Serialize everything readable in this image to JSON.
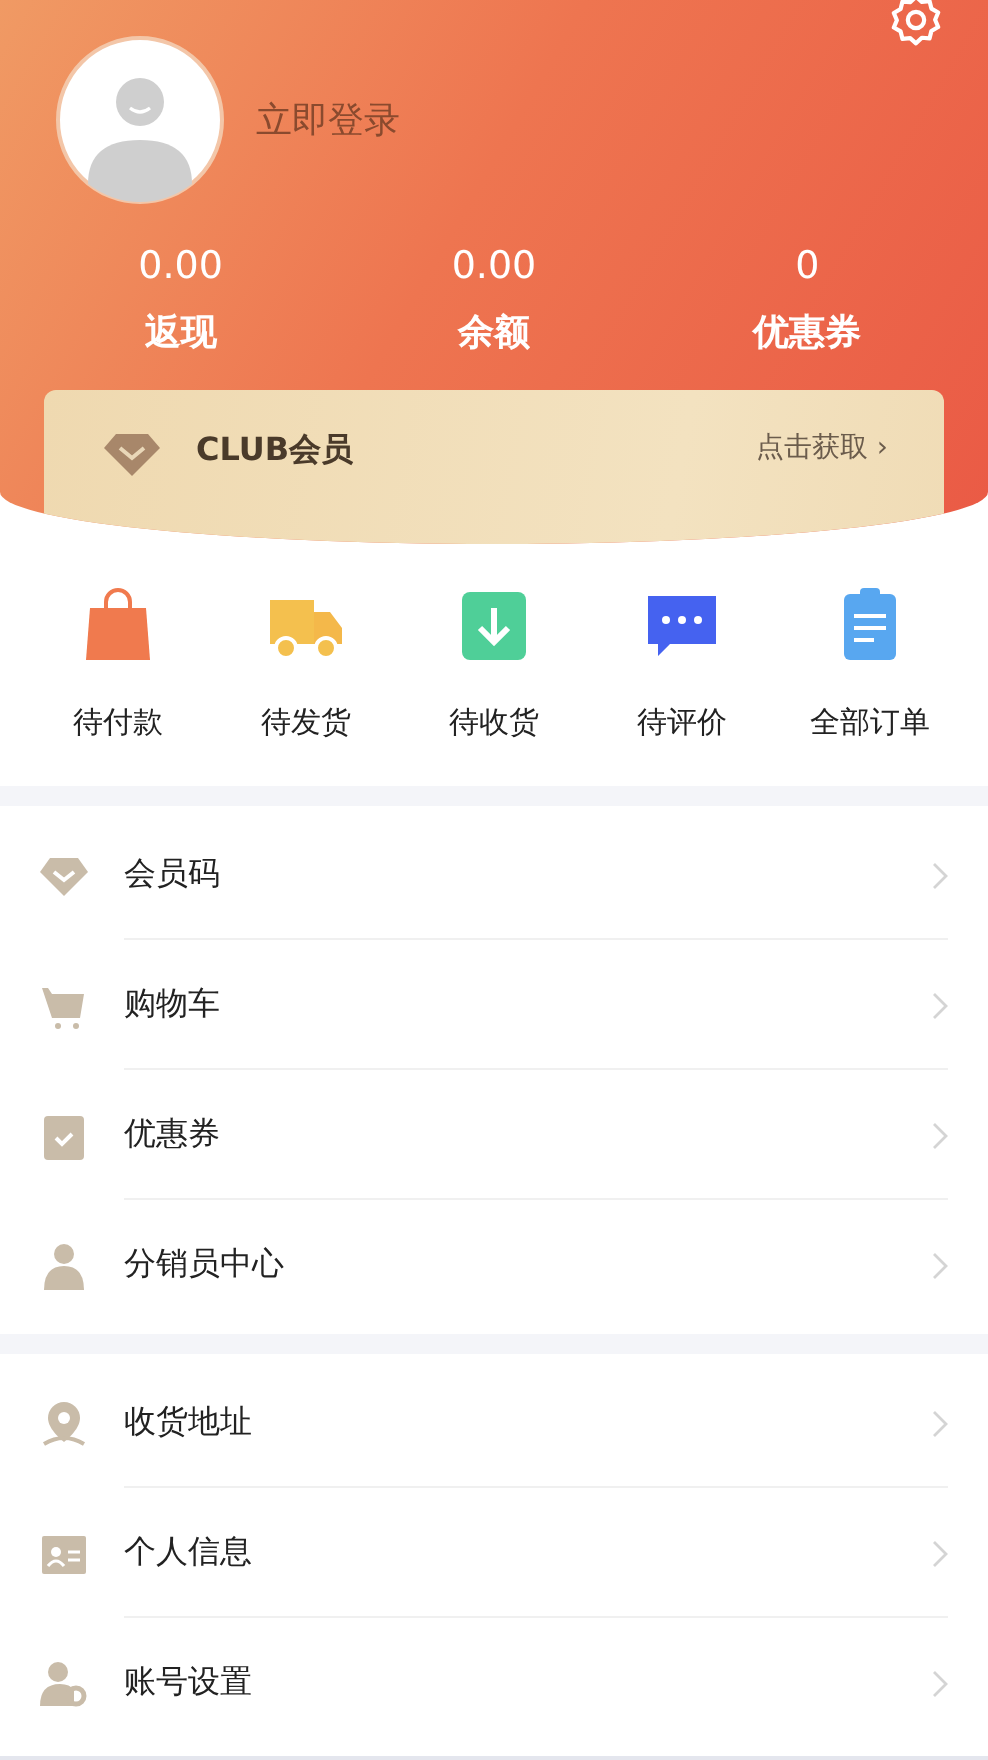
{
  "header": {
    "login_label": "立即登录"
  },
  "stats": [
    {
      "value": "0.00",
      "label": "返现"
    },
    {
      "value": "0.00",
      "label": "余额"
    },
    {
      "value": "0",
      "label": "优惠券"
    }
  ],
  "club_card": {
    "title": "CLUB会员",
    "action": "点击获取",
    "chevron": "›"
  },
  "orders": [
    {
      "kind": "bag",
      "label": "待付款"
    },
    {
      "kind": "truck",
      "label": "待发货"
    },
    {
      "kind": "receive",
      "label": "待收货"
    },
    {
      "kind": "chat",
      "label": "待评价"
    },
    {
      "kind": "list",
      "label": "全部订单"
    }
  ],
  "menu_groups": [
    {
      "items": [
        {
          "kind": "diamond",
          "label": "会员码"
        },
        {
          "kind": "cart",
          "label": "购物车"
        },
        {
          "kind": "coupon",
          "label": "优惠券"
        },
        {
          "kind": "person",
          "label": "分销员中心"
        }
      ]
    },
    {
      "items": [
        {
          "kind": "pin",
          "label": "收货地址"
        },
        {
          "kind": "card",
          "label": "个人信息"
        },
        {
          "kind": "user-gear",
          "label": "账号设置"
        }
      ]
    }
  ]
}
